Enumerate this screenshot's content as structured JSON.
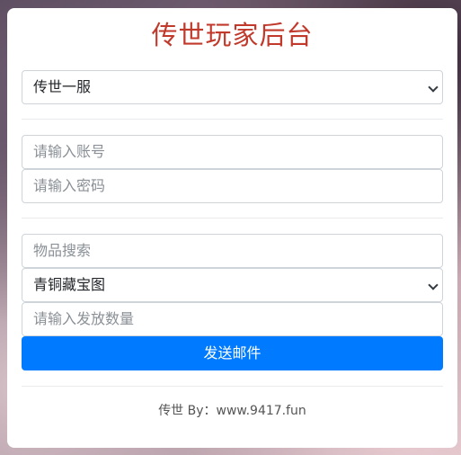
{
  "title": "传世玩家后台",
  "server_select": {
    "value": "传世一服"
  },
  "login": {
    "account_placeholder": "请输入账号",
    "password_placeholder": "请输入密码"
  },
  "mail": {
    "item_search_placeholder": "物品搜索",
    "item_select_value": "青铜藏宝图",
    "quantity_placeholder": "请输入发放数量",
    "send_label": "发送邮件"
  },
  "footer": {
    "text": "传世 By：www.9417.fun"
  },
  "colors": {
    "title": "#c0392b",
    "button": "#007bff"
  }
}
